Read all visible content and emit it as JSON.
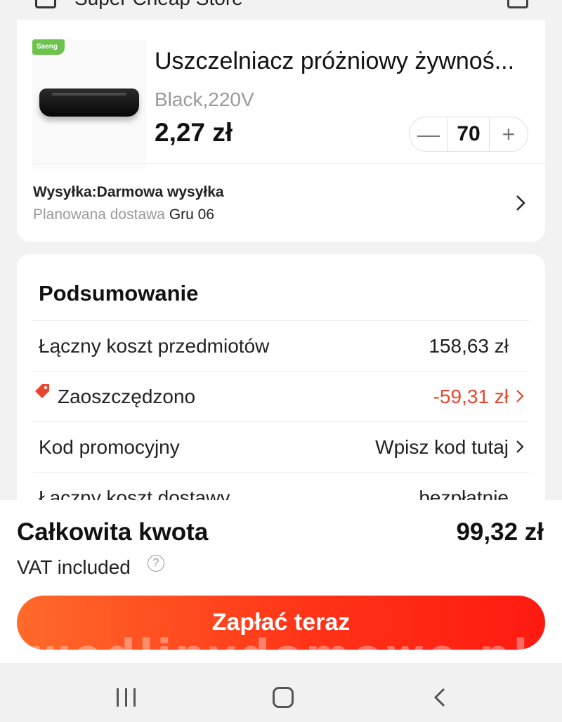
{
  "store": {
    "name": "Super Cheap Store"
  },
  "product": {
    "badge": "Saeng",
    "title": "Uszczelniacz próżniowy żywnoś...",
    "variant": "Black,220V",
    "price": "2,27 zł",
    "quantity": "70",
    "shipping_label": "Wysyłka:Darmowa wysyłka",
    "delivery_prefix": "Planowana dostawa",
    "delivery_date": "Gru 06"
  },
  "summary": {
    "title": "Podsumowanie",
    "rows": [
      {
        "label": "Łączny koszt przedmiotów",
        "value": "158,63 zł"
      },
      {
        "label": "Zaoszczędzono",
        "value": "-59,31 zł"
      },
      {
        "label": "Kod promocyjny",
        "value": "Wpisz kod tutaj"
      },
      {
        "label": "Łączny koszt dostawy",
        "value": "bezpłatnie"
      }
    ]
  },
  "footer": {
    "total_label": "Całkowita kwota",
    "total_value": "99,32 zł",
    "vat_label": "VAT included",
    "pay_button": "Zapłać teraz"
  },
  "watermark": "wedlinydomowe.pl",
  "colors": {
    "accent": "#ff3417",
    "discount": "#e8452c"
  }
}
